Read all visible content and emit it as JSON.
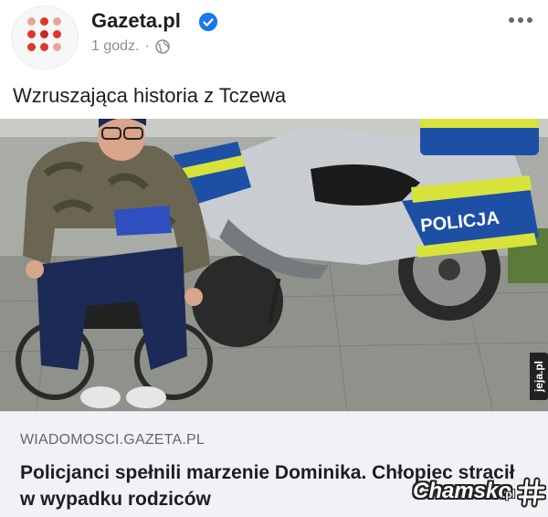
{
  "post": {
    "page_name": "Gazeta.pl",
    "time": "1 godz.",
    "separator": "·",
    "caption": "Wzruszająca historia z Tczewa"
  },
  "photo": {
    "sign_text": "POLICJA",
    "watermark": "jeja.pl"
  },
  "link": {
    "domain": "WIADOMOSCI.GAZETA.PL",
    "headline": "Policjanci spełnili marzenie Dominika. Chłopiec stracił w wypadku rodziców"
  },
  "watermark": {
    "name": "Chamsko",
    "suffix": ".pl"
  },
  "colors": {
    "brand_red": "#e0352b",
    "verified_blue": "#1877f2",
    "police_blue": "#1d4fa5",
    "police_yellow": "#d7e33a"
  }
}
